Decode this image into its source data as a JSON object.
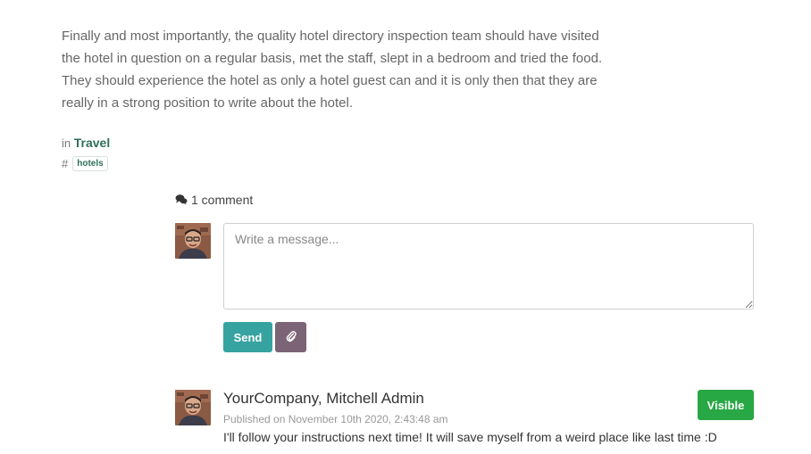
{
  "article": {
    "lines": [
      "Finally and most importantly, the quality hotel directory inspection team should have visited",
      "the hotel in question on a regular basis, met the staff, slept in a bedroom and tried the food.",
      "They should experience the hotel as only a hotel guest can and it is only then that they are",
      "really in a strong position to write about the hotel."
    ]
  },
  "meta": {
    "in_label": "in",
    "category": "Travel",
    "hash": "#",
    "tags": [
      "hotels"
    ]
  },
  "comments": {
    "count_label": "1 comment",
    "composer": {
      "placeholder": "Write a message...",
      "send_label": "Send"
    },
    "items": [
      {
        "author": "YourCompany, Mitchell Admin",
        "published": "Published on November 10th 2020, 2:43:48 am",
        "body": "I'll follow your instructions next time! It will save myself from a weird place like last time :D",
        "visibility_label": "Visible"
      }
    ]
  },
  "colors": {
    "send": "#36a3a0",
    "attach": "#7b6476",
    "visible": "#28a745",
    "link": "#2f6f5a"
  },
  "icons": {
    "comments": "comments-icon",
    "attach": "paperclip-icon"
  }
}
